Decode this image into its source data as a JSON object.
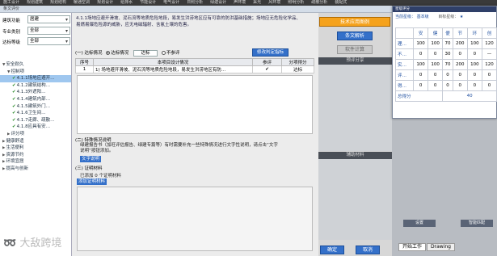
{
  "menubar": [
    "施工设计",
    "规划建筑",
    "规划结构",
    "暖通空调",
    "规划设计",
    "给排水",
    "节能设计",
    "电气设计",
    "日照分析",
    "绿建设计",
    "声环境",
    "采光",
    "风环境",
    "照明分析",
    "疏散分析",
    "装配式"
  ],
  "window_title": "条文评价",
  "filters": {
    "region_label": "建筑功能",
    "region_value": "居建",
    "major_label": "专业类别",
    "major_value": "全部",
    "level_label": "达标等级",
    "level_value": "全部"
  },
  "tree": [
    {
      "label": "安全耐久",
      "indent": 0,
      "toggle": "−"
    },
    {
      "label": "控制项",
      "indent": 1,
      "toggle": "−"
    },
    {
      "label": "4.1.1场地应避开…",
      "indent": 2,
      "check": true,
      "selected": true
    },
    {
      "label": "4.1.2建筑结构…",
      "indent": 2,
      "check": true
    },
    {
      "label": "4.1.3外遮阳…",
      "indent": 2,
      "check": true
    },
    {
      "label": "4.1.4建筑内部…",
      "indent": 2,
      "check": true
    },
    {
      "label": "4.1.5建筑外门…",
      "indent": 2,
      "check": true
    },
    {
      "label": "4.1.6卫生间…",
      "indent": 2,
      "check": true
    },
    {
      "label": "4.1.7走廊、疏散…",
      "indent": 2,
      "check": true
    },
    {
      "label": "4.1.8应具有安…",
      "indent": 2,
      "check": true
    },
    {
      "label": "评分项",
      "indent": 1,
      "toggle": "+"
    },
    {
      "label": "健康舒适",
      "indent": 0,
      "toggle": "+"
    },
    {
      "label": "生活便利",
      "indent": 0,
      "toggle": "+"
    },
    {
      "label": "资源节约",
      "indent": 0,
      "toggle": "+"
    },
    {
      "label": "环境宜居",
      "indent": 0,
      "toggle": "+"
    },
    {
      "label": "提高与创新",
      "indent": 0,
      "toggle": "+"
    }
  ],
  "description": "4.1.1场地应避开滑坡、泥石流等地质危险地段，易发生洪涝地区应有可靠的防洪基础措施；场地应无危险化学品、易燃易爆危险源的威胁，应无电磁辐射、含氡土壤的危害。",
  "section1": {
    "title": "(一) 达标情况",
    "opt_status": "达标情况",
    "status_value": "达标",
    "opt_na": "不参评",
    "modify_button": "修改判定指标"
  },
  "table": {
    "headers": [
      "序号",
      "本项目设计情况",
      "参评",
      "分项得分"
    ],
    "rows": [
      {
        "no": "1",
        "text": "1) 场地避开滑坡、泥石流等地质危险地段，易发生洪涝地区有防…",
        "check": "✔",
        "score": "达标"
      }
    ]
  },
  "section2": {
    "title": "(二) 特殊情况说明",
    "note": "绿建报告书（加旺评估报告、绿建专篇等）有时需要补充一些特殊情况进行文字性说明，请点击“文字说明”按钮添加。",
    "button": "文字说明"
  },
  "section3": {
    "title": "(三) 证明材料",
    "count_text": "已添加 0 个证明材料",
    "add_button": "添加证明材料"
  },
  "right_buttons": {
    "tech": "技术应用图例",
    "condition": "条文解析",
    "software": "软件计算",
    "pre_eval": "预评分享",
    "materials": "辅助材料",
    "ok": "确定",
    "cancel": "取消"
  },
  "score_popup": {
    "title": "星级评分",
    "star_label": "当前星级：",
    "star_value": "基本级",
    "target_label": "目标星级：",
    "target_value": "★",
    "headers": [
      "",
      "安",
      "健",
      "便",
      "节",
      "环",
      "创"
    ],
    "rows": [
      {
        "label": "理…",
        "values": [
          "100",
          "100",
          "70",
          "200",
          "100",
          "120"
        ]
      },
      {
        "label": "不…",
        "values": [
          "0",
          "0",
          "30",
          "0",
          "0",
          "—"
        ]
      },
      {
        "label": "实…",
        "values": [
          "100",
          "100",
          "70",
          "200",
          "100",
          "120"
        ]
      },
      {
        "label": "评…",
        "values": [
          "0",
          "0",
          "0",
          "0",
          "0",
          "0"
        ]
      },
      {
        "label": "得…",
        "values": [
          "0",
          "0",
          "0",
          "0",
          "0",
          "0"
        ]
      }
    ],
    "total_label": "总得分",
    "total_value": "40"
  },
  "far_buttons": {
    "settings": "设置",
    "smart": "智能匹配"
  },
  "tabs": [
    "开始工作",
    "Drawing"
  ],
  "watermark": "大敌跨境",
  "colors": {
    "accent": "#3470c9",
    "orange": "#f5a21c",
    "popup_title": "#2f3f68"
  }
}
